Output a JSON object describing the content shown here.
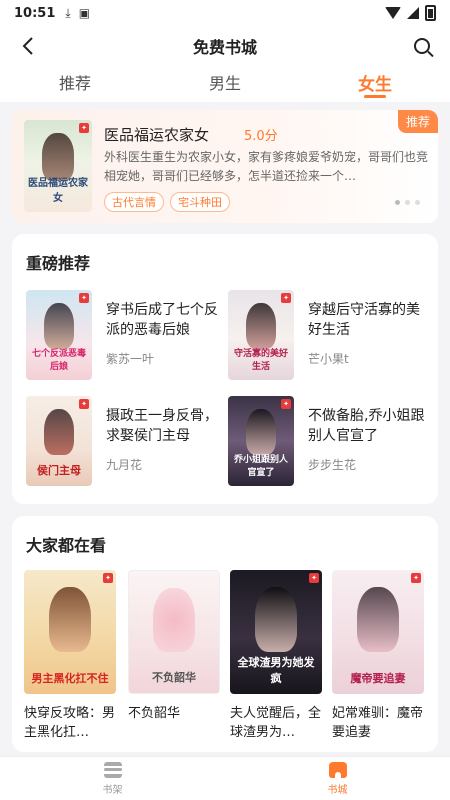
{
  "status_bar": {
    "time": "10:51"
  },
  "header": {
    "title": "免费书城"
  },
  "tabs": [
    {
      "label": "推荐",
      "active": false
    },
    {
      "label": "男生",
      "active": false
    },
    {
      "label": "女生",
      "active": true
    }
  ],
  "featured": {
    "badge": "推荐",
    "title": "医品福运农家女",
    "score": "5.0分",
    "description": "外科医生重生为农家小女，家有爹疼娘爱爷奶宠，哥哥们也竞相宠她，哥哥们已经够多，怎半道还捡来一个…",
    "tags": [
      "古代言情",
      "宅斗种田"
    ],
    "cover_text": "医品福运农家女"
  },
  "heavy_recommend": {
    "title": "重磅推荐",
    "books": [
      {
        "title": "穿书后成了七个反派的恶毒后娘",
        "author": "紫苏一叶",
        "cover_text": "七个反派恶毒后娘"
      },
      {
        "title": "穿越后守活寡的美好生活",
        "author": "芒小果t",
        "cover_text": "守活寡的美好生活"
      },
      {
        "title": "摄政王一身反骨，求娶侯门主母",
        "author": "九月花",
        "cover_text": "侯门主母"
      },
      {
        "title": "不做备胎,乔小姐跟别人官宣了",
        "author": "步步生花",
        "cover_text": "乔小姐跟别人官宣了"
      }
    ]
  },
  "everyone_watching": {
    "title": "大家都在看",
    "books": [
      {
        "title": "快穿反攻略：男主黑化扛…",
        "cover_text": "男主黑化扛不住"
      },
      {
        "title": "不负韶华",
        "cover_text": "不负韶华"
      },
      {
        "title": "夫人觉醒后，全球渣男为…",
        "cover_text": "全球渣男为她发疯"
      },
      {
        "title": "妃常难驯：魔帝要追妻",
        "cover_text": "魔帝要追妻"
      }
    ]
  },
  "bottom_nav": [
    {
      "label": "书架",
      "active": false
    },
    {
      "label": "书城",
      "active": true
    }
  ],
  "colors": {
    "accent": "#ff7a2e",
    "background": "#f4f4f6"
  }
}
